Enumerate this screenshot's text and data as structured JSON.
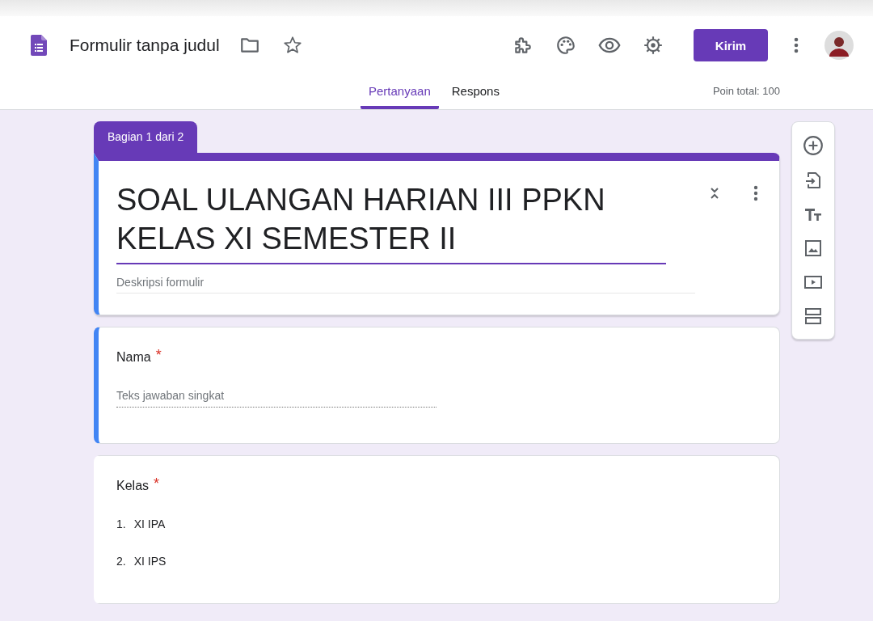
{
  "header": {
    "title": "Formulir tanpa judul",
    "send_button": "Kirim"
  },
  "tabs": [
    {
      "label": "Pertanyaan",
      "selected": true
    },
    {
      "label": "Respons",
      "selected": false
    }
  ],
  "total_points": "Poin total: 100",
  "section_tab": "Bagian 1 dari 2",
  "form": {
    "title": "SOAL ULANGAN HARIAN III PPKN KELAS XI SEMESTER II",
    "description_placeholder": "Deskripsi formulir",
    "focused": true
  },
  "questions": [
    {
      "kind": "short",
      "title": "Nama",
      "required": true,
      "focused": true,
      "placeholder": "Teks jawaban singkat"
    },
    {
      "kind": "list",
      "title": "Kelas",
      "required": true,
      "focused": false,
      "options": [
        {
          "number": "1.",
          "label": "XI IPA"
        },
        {
          "number": "2.",
          "label": "XI IPS"
        }
      ]
    }
  ],
  "required_mark": "*"
}
